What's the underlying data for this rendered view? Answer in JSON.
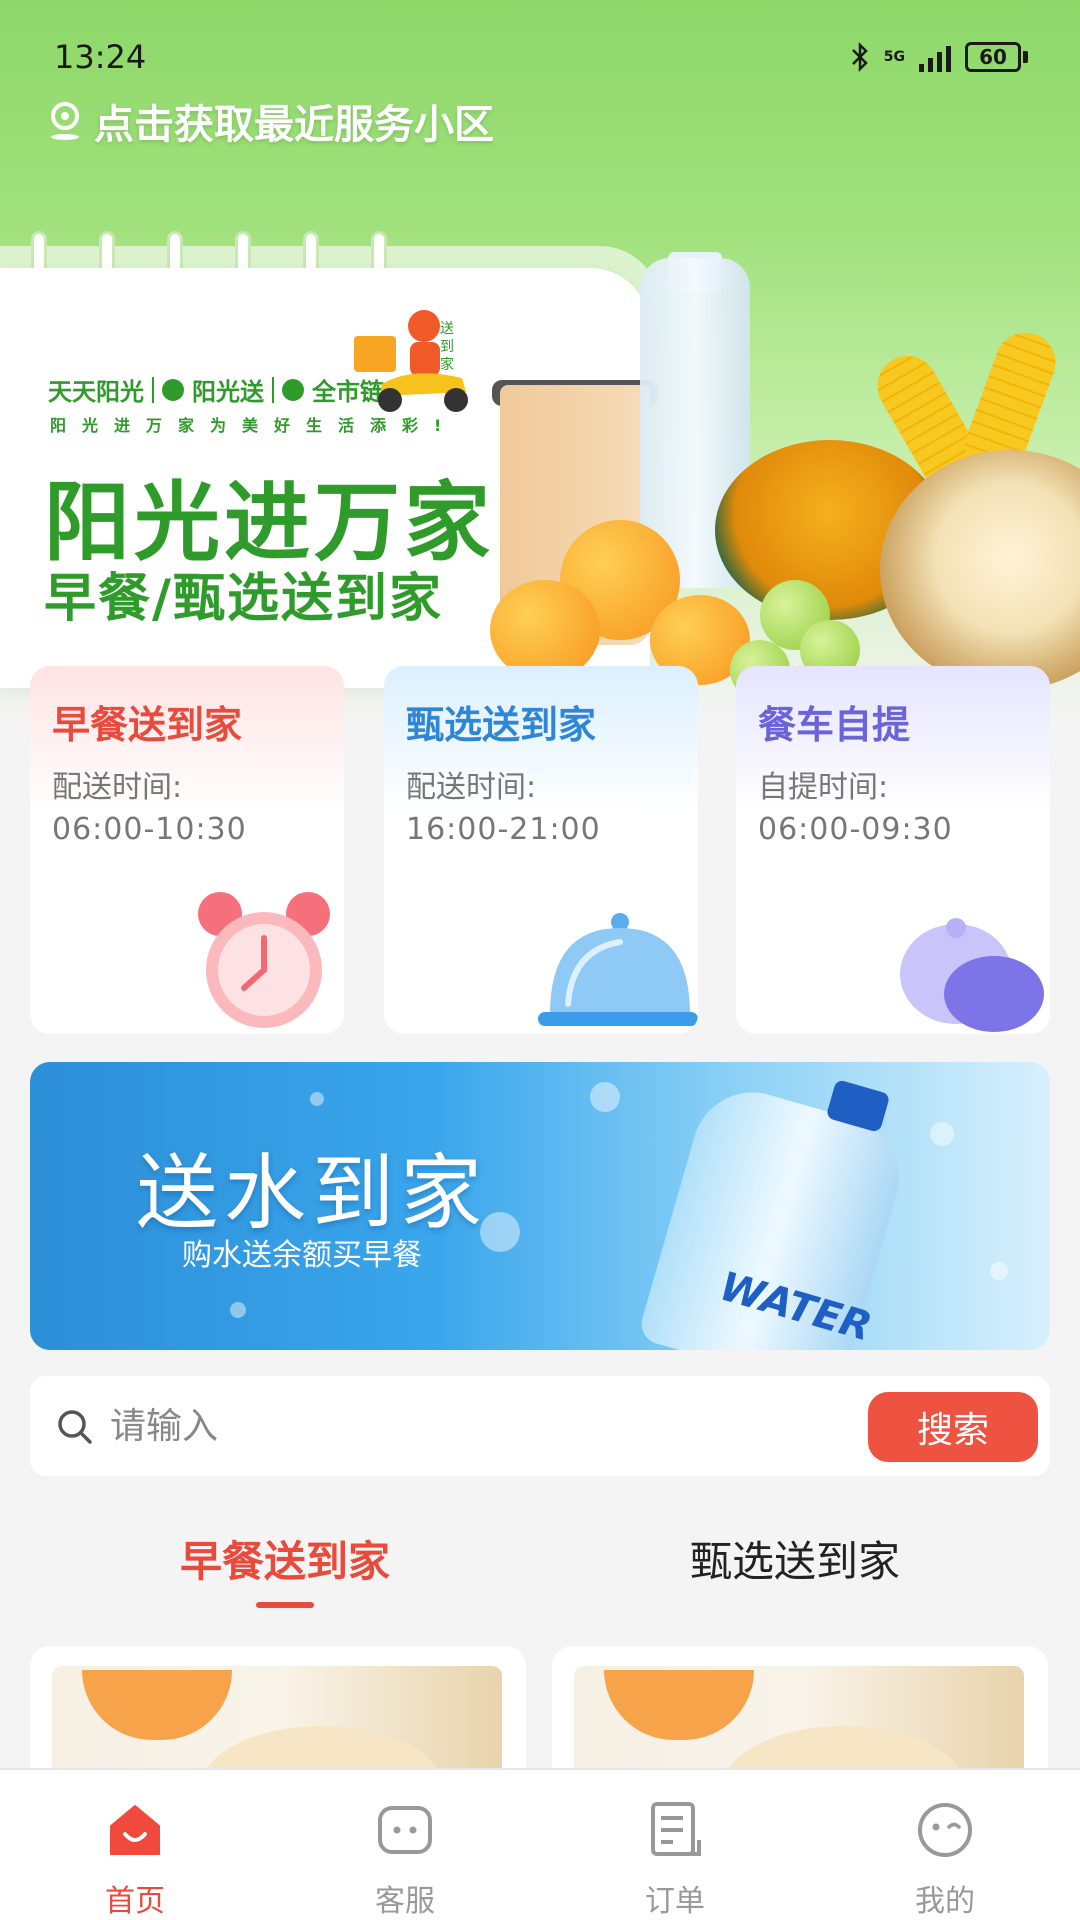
{
  "status_bar": {
    "time": "13:24",
    "network": "5G",
    "battery": "60"
  },
  "location": {
    "label": "点击获取最近服务小区"
  },
  "hero_banner": {
    "brands": [
      "天天阳光",
      "阳光送",
      "全市链"
    ],
    "slogan": "阳光进万家为美好生活添彩!",
    "title": "阳光进万家",
    "subtitle": "早餐/甄选送到家",
    "rider_tag": "送到家"
  },
  "services": [
    {
      "title": "早餐送到家",
      "time_label": "配送时间:",
      "time_value": "06:00-10:30"
    },
    {
      "title": "甄选送到家",
      "time_label": "配送时间:",
      "time_value": "16:00-21:00"
    },
    {
      "title": "餐车自提",
      "time_label": "自提时间:",
      "time_value": "06:00-09:30"
    }
  ],
  "water_banner": {
    "title": "送水到家",
    "subtitle": "购水送余额买早餐",
    "bottle_label": "WATER"
  },
  "search": {
    "placeholder": "请输入",
    "button": "搜索"
  },
  "tabs": [
    {
      "label": "早餐送到家",
      "active": true
    },
    {
      "label": "甄选送到家",
      "active": false
    }
  ],
  "bottom_nav": [
    {
      "label": "首页",
      "icon": "home-icon",
      "active": true
    },
    {
      "label": "客服",
      "icon": "chat-icon",
      "active": false
    },
    {
      "label": "订单",
      "icon": "order-icon",
      "active": false
    },
    {
      "label": "我的",
      "icon": "profile-icon",
      "active": false
    }
  ],
  "colors": {
    "accent": "#e84b3c",
    "brand_green": "#2f9b2a",
    "blue": "#2f86d6",
    "purple": "#6b63d8"
  }
}
